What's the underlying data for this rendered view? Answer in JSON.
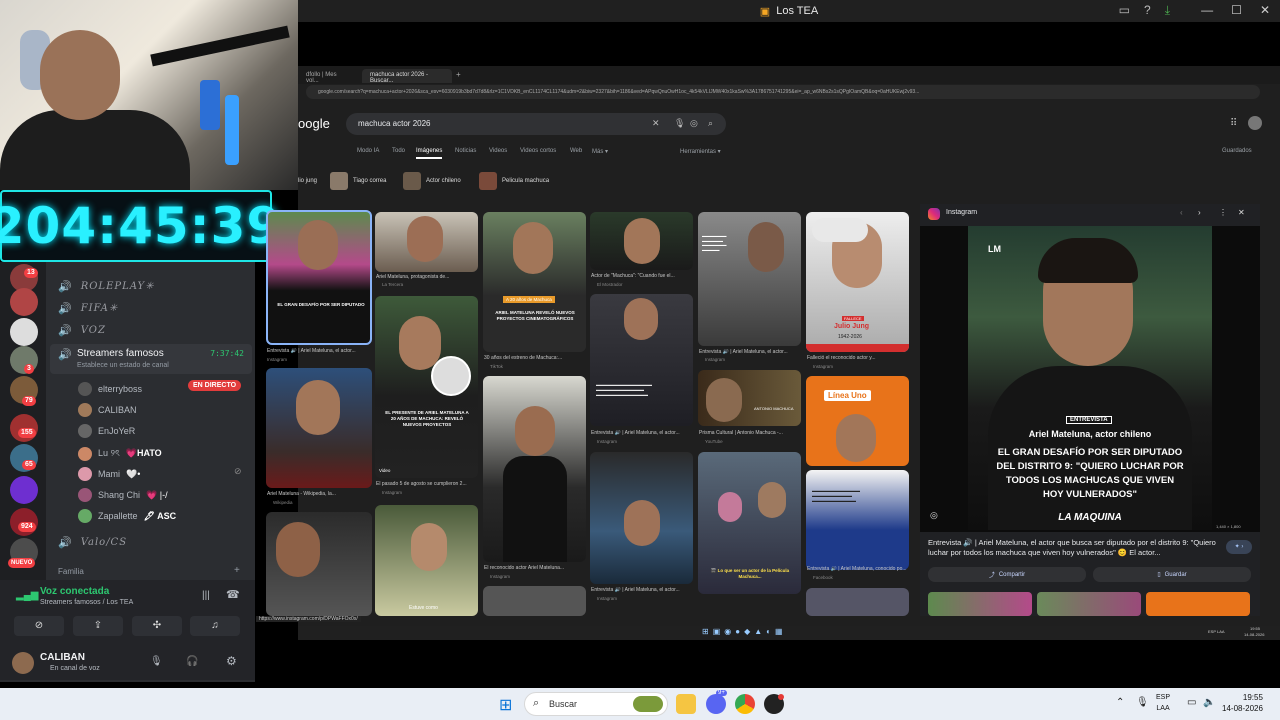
{
  "host_window": {
    "title": "Los TEA",
    "icons": [
      "screen-icon",
      "help-icon",
      "download-icon"
    ],
    "controls": [
      "—",
      "☐",
      "✕"
    ]
  },
  "stream_overlay": {
    "timer": "204:45:39"
  },
  "discord": {
    "servers": [
      {
        "badge": "13"
      },
      {
        "badge": ""
      },
      {
        "badge": ""
      },
      {
        "badge": "3"
      },
      {
        "badge": "79"
      },
      {
        "badge": "155"
      },
      {
        "badge": "65"
      },
      {
        "badge": ""
      },
      {
        "badge": "924"
      },
      {
        "badge": "NUEVO"
      }
    ],
    "channels": [
      {
        "name": "ROLEPLAY✳"
      },
      {
        "name": "FIFA✳"
      },
      {
        "name": "VOZ"
      }
    ],
    "active_channel": {
      "name": "Streamers famosos",
      "time": "7:37:42",
      "status_placeholder": "Establece un estado de canal"
    },
    "voice_users": [
      {
        "name": "elterryboss",
        "badge": "EN DIRECTO"
      },
      {
        "name": "CALIBAN",
        "badge": ""
      },
      {
        "name": "EnJoYeR",
        "badge": ""
      },
      {
        "name": "Lu ୨ৎ",
        "badge": "💗HATO"
      },
      {
        "name": "Mami",
        "badge": "🤍•"
      },
      {
        "name": "Shang Chi",
        "badge": "💗 |-/"
      },
      {
        "name": "Zapallette",
        "badge": "🖋 ASC"
      }
    ],
    "other_channels": [
      {
        "name": "Valo/CS"
      }
    ],
    "category": "Familia",
    "voice": {
      "status": "Voz conectada",
      "location": "Streamers famosos / Los TEA"
    },
    "user_panel": {
      "name": "CALIBAN",
      "status": "En canal de voz"
    }
  },
  "browser": {
    "tabs": [
      {
        "label": "dfollo | Mes vol..."
      },
      {
        "label": "machuca actor 2026 - Buscar..."
      }
    ],
    "url": "google.com/search?q=machuca+actor+2026&sca_esv=6030919b3bd7d7d8&rlz=1C1VDKB_enCL1174CL1174&udm=2&biw=2327&bih=1186&ved=APqwQnuOwH1oc_4k54kVLIJMW40x1kaSw%3A1786751741295&ei=_ap_w6NBs2s1sQPgIOamQB&oq=0aHUKEwj2v93..."
  },
  "google": {
    "logo": "oogle",
    "query": "machuca actor 2026",
    "tabs": [
      "Modo IA",
      "Todo",
      "Imágenes",
      "Noticias",
      "Videos",
      "Videos cortos",
      "Web",
      "Más ▾"
    ],
    "tools": "Herramientas ▾",
    "saved": "Guardados",
    "chips": [
      "lio jung",
      "Tiago correa",
      "Actor chileno",
      "Pelicula machuca"
    ],
    "results": [
      {
        "caption": "Entrevista 🔊 | Ariel Mateluna, el actor...",
        "source": "Instagram"
      },
      {
        "caption": "Ariel Mateluna, protagonista de...",
        "source": "La Tercera"
      },
      {
        "caption": "30 años del estreno de Machuca:...",
        "source": "TikTok"
      },
      {
        "caption": "Actor de \"Machuca\": \"Cuando fue el...",
        "source": "El Mostrador"
      },
      {
        "caption": "Entrevista 🔊 | Ariel Mateluna, el actor...",
        "source": "Instagram"
      },
      {
        "caption": "Falleció el reconocido actor y...",
        "source": "Instagram"
      },
      {
        "caption": "Ariel Mateluna - Wikipedia, la...",
        "source": "Wikipedia"
      },
      {
        "caption": "El pasado 5 de agosto se cumplieron 2...",
        "source": "Instagram"
      },
      {
        "caption": "El reconocido actor Ariel Mateluna...",
        "source": "Instagram"
      },
      {
        "caption": "Entrevista 🔊 | Ariel Mateluna, el actor...",
        "source": "Instagram"
      },
      {
        "caption": "Prisma Cultural | Antonio Machuca -...",
        "source": "YouTube"
      },
      {
        "caption": "Entrevista 🔊 | Ariel Mateluna, el actor...",
        "source": "Instagram"
      },
      {
        "caption": "Entrevista 🔊 | Ariel Mateluna, el actor...",
        "source": "Instagram"
      },
      {
        "caption": "🎬 Lo que ser un actor de la Película Machuca...",
        "source": ""
      },
      {
        "caption": "Entrevista 🔊 | Ariel Mateluna, conocido po...",
        "source": "Facebook"
      },
      {
        "caption": "Estuve como",
        "source": ""
      }
    ],
    "overlays": {
      "julio_jung_name": "Julio Jung",
      "julio_jung_years": "1942-2026",
      "julio_jung_tag": "FALLECE",
      "linea_uno": "Línea Uno",
      "revelo": "ARIEL MATELUNA REVELÓ NUEVOS PROYECTOS CINEMATOGRÁFICOS",
      "veinte_anos": "A 20 años de Machuca",
      "presente": "EL PRESENTE DE ARIEL MATELUNA A 20 AÑOS DE MACHUCA: REVELÓ NUEVOS PROYECTOS",
      "video_label": "Video"
    },
    "status_url": "https://www.instagram.com/p/DPWaFFOx0x/"
  },
  "preview": {
    "source": "Instagram",
    "image_text": {
      "logo": "LM",
      "tag": "ENTREVISTA",
      "line1": "Ariel Mateluna, actor chileno",
      "line2": "EL GRAN DESAFÍO POR SER DIPUTADO",
      "line3": "DEL DISTRITO 9: \"QUIERO LUCHAR POR",
      "line4": "TODOS LOS MACHUCAS QUE VIVEN",
      "line5": "HOY VULNERADOS\"",
      "brand": "LA MAQUINA",
      "dims": "1,440 × 1,800"
    },
    "caption": "Entrevista 🔊 | Ariel Mateluna, el actor que busca ser diputado por el distrito 9: \"Quiero luchar por todos los machuca que viven hoy vulnerados\" 😊 El actor...",
    "share": "Compartir",
    "save": "Guardar"
  },
  "inner_taskbar": {
    "lang": "ESP LAA",
    "time": "19:55",
    "date": "14-08-2026"
  },
  "taskbar": {
    "search_placeholder": "Buscar",
    "lang_top": "ESP",
    "lang_bottom": "LAA",
    "time": "19:55",
    "date": "14-08-2026",
    "discord_badge": "9+"
  }
}
